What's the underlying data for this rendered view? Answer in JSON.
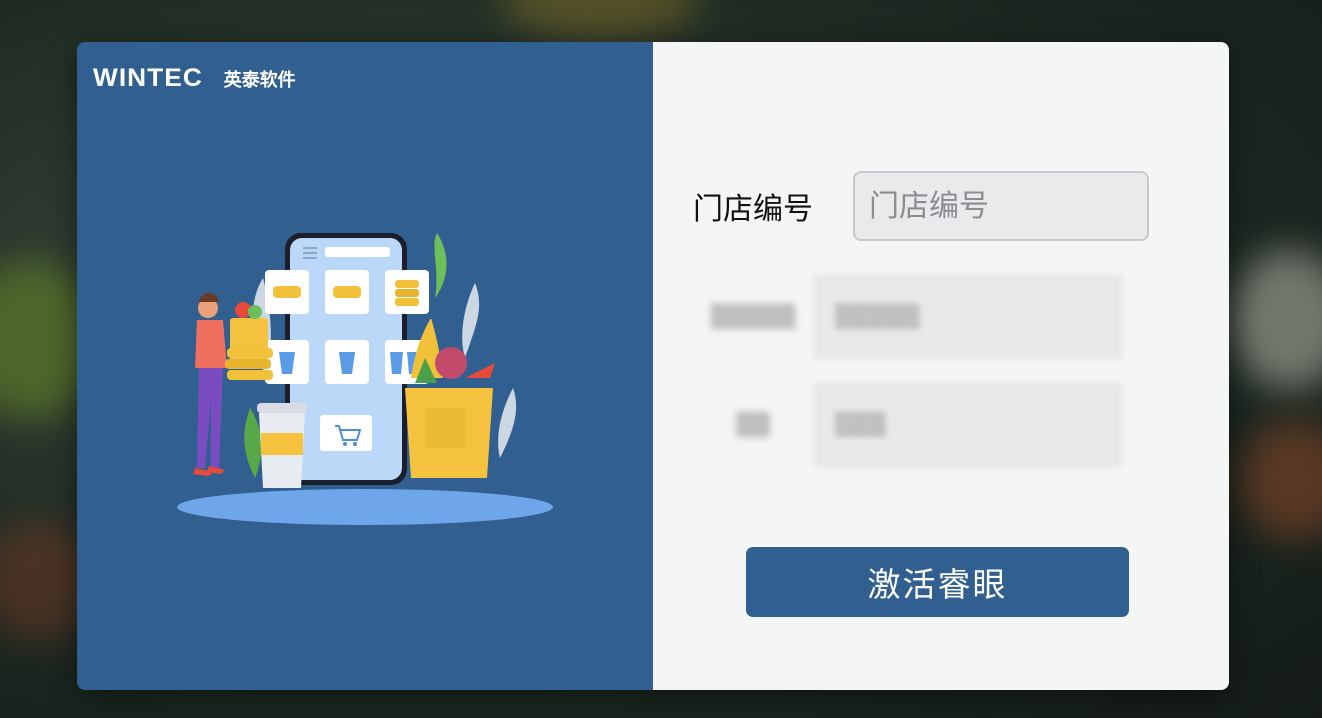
{
  "brand": {
    "logo_text": "WINTEC",
    "name": "英泰软件"
  },
  "form": {
    "store_number": {
      "label": "门店编号",
      "placeholder": "门店编号",
      "value": ""
    },
    "field_2": {
      "label": "▒▒▒▒▒",
      "value": "▒▒▒▒▒"
    },
    "field_3": {
      "label": "▒▒",
      "value": "▒▒▒"
    }
  },
  "actions": {
    "activate_label": "激活睿眼"
  },
  "colors": {
    "primary": "#316090",
    "panel": "#f4f5f5",
    "input_bg": "#e9eaec"
  },
  "illustration": {
    "icon": "shopping-app-illustration"
  }
}
